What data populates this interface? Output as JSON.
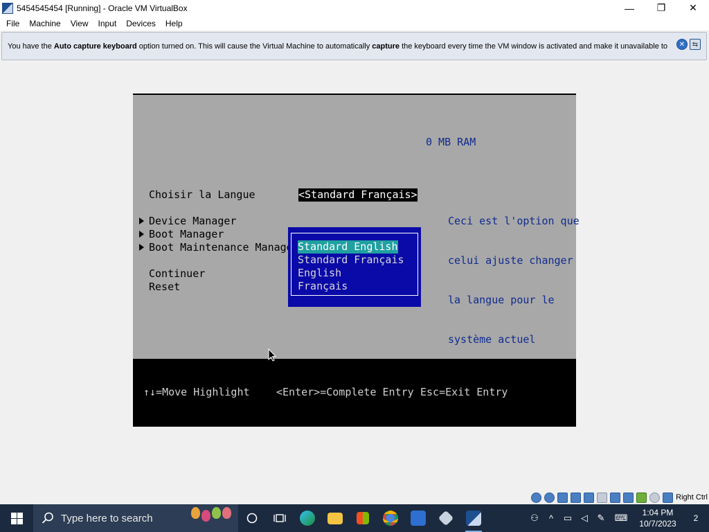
{
  "window": {
    "title": "5454545454 [Running] - Oracle VM VirtualBox",
    "minimize": "—",
    "maximize": "❐",
    "close": "✕"
  },
  "menu": [
    "File",
    "Machine",
    "View",
    "Input",
    "Devices",
    "Help"
  ],
  "notification": {
    "part1": "You have the ",
    "bold1": "Auto capture keyboard",
    "part2": " option turned on. This will cause the Virtual Machine to automatically ",
    "bold2": "capture",
    "part3": " the keyboard every time the VM window is activated and make it unavailable to"
  },
  "bios": {
    "ram": "0 MB RAM",
    "language_label": "Choisir la Langue",
    "language_value": "<Standard Français>",
    "menu_items": [
      "Device Manager",
      "Boot Manager",
      "Boot Maintenance Manager"
    ],
    "continue": "Continuer",
    "reset": "Reset",
    "help_lines": [
      "Ceci est l'option que",
      "celui ajuste changer",
      "la langue pour le",
      "système actuel"
    ],
    "popup_options": [
      "Standard English",
      "Standard Français",
      "English",
      "Français"
    ],
    "popup_selected": 0,
    "footer": {
      "move": "↑↓=Move Highlight",
      "enter": "<Enter>=Complete Entry",
      "esc": "Esc=Exit Entry"
    }
  },
  "statusbar": {
    "host_key": "Right Ctrl"
  },
  "taskbar": {
    "search_placeholder": "Type here to search",
    "time": "1:04 PM",
    "date": "10/7/2023",
    "notification_count": "2"
  },
  "colors": {
    "bios_bg": "#a8a8a8",
    "popup_bg": "#0a0aa8",
    "highlight": "#20a0a0",
    "help_text": "#102b8f",
    "taskbar": "#1b2a3f"
  }
}
